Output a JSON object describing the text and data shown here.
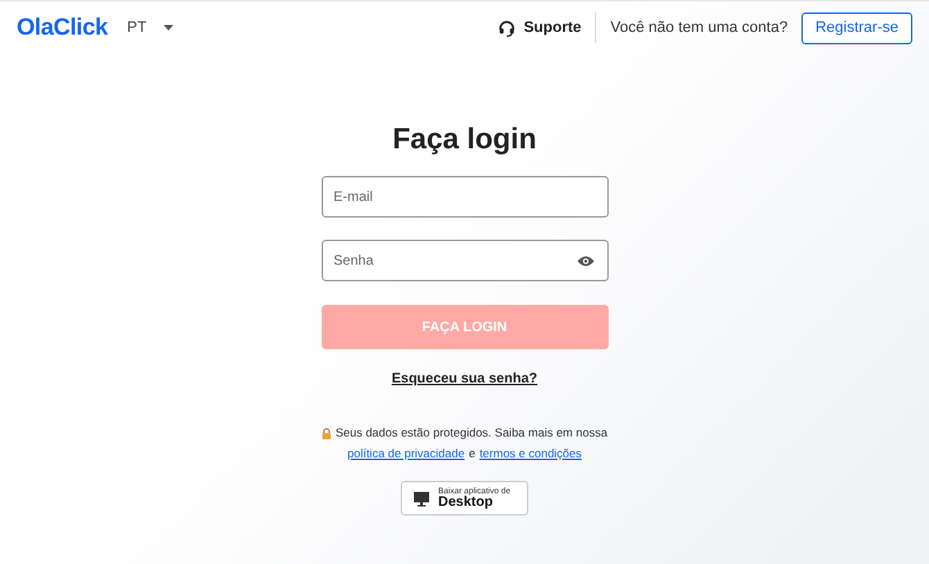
{
  "header": {
    "logo": "OlaClick",
    "language": "PT",
    "support": "Suporte",
    "no_account": "Você não tem uma conta?",
    "register": "Registrar-se"
  },
  "login": {
    "title": "Faça login",
    "fields": [
      {
        "kind": "text",
        "placeholder": "E-mail"
      },
      {
        "kind": "password",
        "placeholder": "Senha"
      }
    ],
    "submit": {
      "label": "FAÇA LOGIN",
      "disabled": true
    },
    "forgot": "Esqueceu sua senha?",
    "privacy": {
      "text": "Seus dados estão protegidos. Saiba mais em nossa",
      "link_1": "política de privacidade",
      "joiner": "e",
      "link_2": "termos e condições"
    },
    "download": {
      "small": "Baixar aplicativo de",
      "big": "Desktop"
    }
  }
}
